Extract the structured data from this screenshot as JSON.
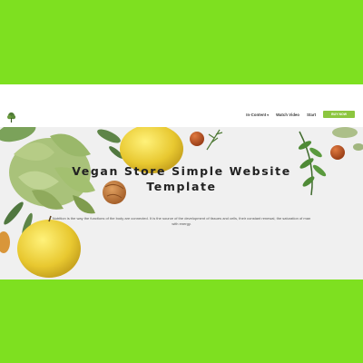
{
  "nav": {
    "items": [
      {
        "label": "In-Content",
        "caret": "▾"
      },
      {
        "label": "Watch Video"
      },
      {
        "label": "Start"
      }
    ],
    "cta_label": "BUY NOW"
  },
  "hero": {
    "title": "Vegan Store Simple Website Template",
    "subtitle": "Nutrition is the way the functions of the body are connected. It is the source of the development of tissues and cells, their constant renewal, the saturation of man with energy."
  },
  "colors": {
    "outer_background": "#7ee020",
    "accent": "#8cc63f"
  },
  "icons": {
    "logo": "tree-logo-icon"
  }
}
